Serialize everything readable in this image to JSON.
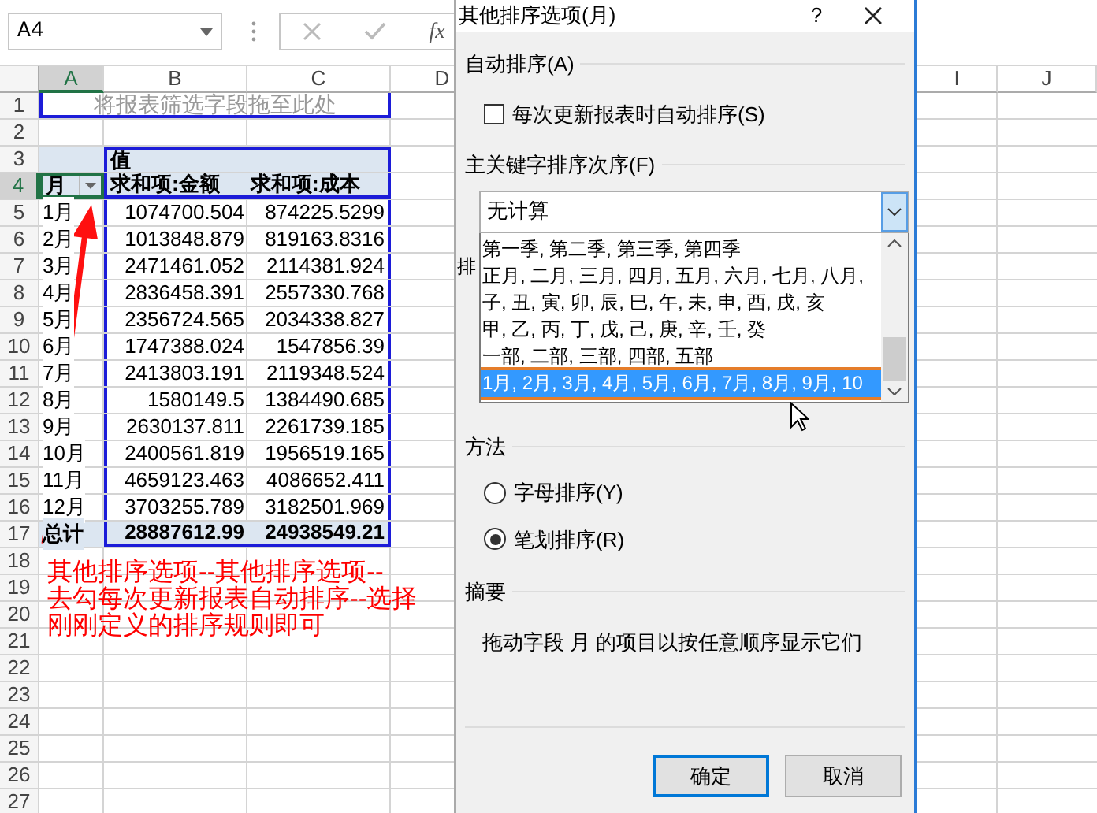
{
  "name_box": "A4",
  "fx_label": "fx",
  "column_headers": [
    {
      "label": "A",
      "selected": true
    },
    {
      "label": "B",
      "selected": false
    },
    {
      "label": "C",
      "selected": false
    },
    {
      "label": "D",
      "selected": false
    },
    {
      "label": "I",
      "selected": false
    },
    {
      "label": "J",
      "selected": false
    }
  ],
  "row_numbers": [
    {
      "label": "1",
      "selected": false
    },
    {
      "label": "2",
      "selected": false
    },
    {
      "label": "3",
      "selected": false
    },
    {
      "label": "4",
      "selected": true
    },
    {
      "label": "5",
      "selected": false
    },
    {
      "label": "6",
      "selected": false
    },
    {
      "label": "7",
      "selected": false
    },
    {
      "label": "8",
      "selected": false
    },
    {
      "label": "9",
      "selected": false
    },
    {
      "label": "10",
      "selected": false
    },
    {
      "label": "11",
      "selected": false
    },
    {
      "label": "12",
      "selected": false
    },
    {
      "label": "13",
      "selected": false
    },
    {
      "label": "14",
      "selected": false
    },
    {
      "label": "15",
      "selected": false
    },
    {
      "label": "16",
      "selected": false
    },
    {
      "label": "17",
      "selected": false
    },
    {
      "label": "18",
      "selected": false
    },
    {
      "label": "19",
      "selected": false
    },
    {
      "label": "20",
      "selected": false
    },
    {
      "label": "21",
      "selected": false
    },
    {
      "label": "22",
      "selected": false
    },
    {
      "label": "23",
      "selected": false
    },
    {
      "label": "24",
      "selected": false
    },
    {
      "label": "25",
      "selected": false
    },
    {
      "label": "26",
      "selected": false
    },
    {
      "label": "27",
      "selected": false
    }
  ],
  "pivot": {
    "filter_hint": "将报表筛选字段拖至此处",
    "values_label": "值",
    "row_field": "月",
    "value_headers": [
      "求和项:金额",
      "求和项:成本"
    ],
    "rows": [
      {
        "label": "1月",
        "values": [
          "1074700.504",
          "874225.5299"
        ]
      },
      {
        "label": "2月",
        "values": [
          "1013848.879",
          "819163.8316"
        ]
      },
      {
        "label": "3月",
        "values": [
          "2471461.052",
          "2114381.924"
        ]
      },
      {
        "label": "4月",
        "values": [
          "2836458.391",
          "2557330.768"
        ]
      },
      {
        "label": "5月",
        "values": [
          "2356724.565",
          "2034338.827"
        ]
      },
      {
        "label": "6月",
        "values": [
          "1747388.024",
          "1547856.39"
        ]
      },
      {
        "label": "7月",
        "values": [
          "2413803.191",
          "2119348.524"
        ]
      },
      {
        "label": "8月",
        "values": [
          "1580149.5",
          "1384490.685"
        ]
      },
      {
        "label": "9月",
        "values": [
          "2630137.811",
          "2261739.185"
        ]
      },
      {
        "label": "10月",
        "values": [
          "2400561.819",
          "1956519.165"
        ]
      },
      {
        "label": "11月",
        "values": [
          "4659123.463",
          "4086652.411"
        ]
      },
      {
        "label": "12月",
        "values": [
          "3703255.789",
          "3182501.969"
        ]
      }
    ],
    "total": {
      "label": "总计",
      "values": [
        "28887612.99",
        "24938549.21"
      ]
    }
  },
  "annotation_lines": [
    "其他排序选项--其他排序选项--",
    "去勾每次更新报表自动排序--选择",
    "刚刚定义的排序规则即可"
  ],
  "dialog": {
    "title": "其他排序选项(月)",
    "help": "?",
    "auto_sort": {
      "heading": "自动排序(A)",
      "checkbox": {
        "label": "每次更新报表时自动排序(S)",
        "checked": false
      }
    },
    "key_order": {
      "heading": "主关键字排序次序(F)",
      "value": "无计算",
      "options": [
        {
          "label": "第一季, 第二季, 第三季, 第四季",
          "selected": false
        },
        {
          "label": "正月, 二月, 三月, 四月, 五月, 六月, 七月, 八月,",
          "selected": false
        },
        {
          "label": "子, 丑, 寅, 卯, 辰, 巳, 午, 未, 申, 酉, 戌, 亥",
          "selected": false
        },
        {
          "label": "甲, 乙, 丙, 丁, 戊, 己, 庚, 辛, 壬, 癸",
          "selected": false
        },
        {
          "label": "一部, 二部, 三部, 四部, 五部",
          "selected": false
        },
        {
          "label": "1月, 2月, 3月, 4月, 5月, 6月, 7月, 8月, 9月, 10",
          "selected": true
        }
      ]
    },
    "covered_label": "排",
    "method": {
      "heading": "方法",
      "options": [
        {
          "label": "字母排序(Y)",
          "selected": false
        },
        {
          "label": "笔划排序(R)",
          "selected": true
        }
      ]
    },
    "summary": {
      "heading": "摘要",
      "text": "拖动字段 月 的项目以按任意顺序显示它们"
    },
    "buttons": [
      {
        "label": "确定",
        "default": true
      },
      {
        "label": "取消",
        "default": false
      }
    ]
  }
}
